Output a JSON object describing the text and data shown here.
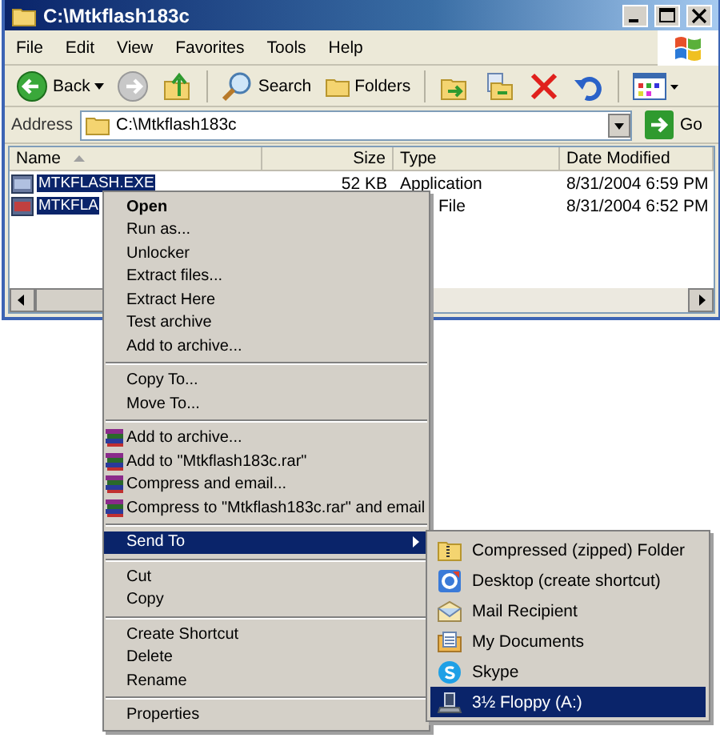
{
  "window": {
    "title": "C:\\Mtkflash183c"
  },
  "menu_bar": [
    "File",
    "Edit",
    "View",
    "Favorites",
    "Tools",
    "Help"
  ],
  "toolbar": [
    {
      "kind": "back",
      "label": "Back"
    },
    {
      "kind": "forward"
    },
    {
      "kind": "up"
    },
    {
      "kind": "separator"
    },
    {
      "kind": "search",
      "label": "Search"
    },
    {
      "kind": "folders",
      "label": "Folders"
    },
    {
      "kind": "separator"
    },
    {
      "kind": "move"
    },
    {
      "kind": "copy"
    },
    {
      "kind": "delete"
    },
    {
      "kind": "undo"
    },
    {
      "kind": "separator"
    },
    {
      "kind": "views"
    }
  ],
  "address": {
    "label": "Address",
    "value": "C:\\Mtkflash183c",
    "go": "Go"
  },
  "file_list": {
    "columns": [
      "Name",
      "Size",
      "Type",
      "Date Modified"
    ],
    "rows": [
      {
        "name": "MTKFLASH.EXE",
        "size": "52 KB",
        "type": "Application",
        "date": "8/31/2004 6:59 PM",
        "selected": true
      },
      {
        "name": "MTKFLA",
        "type": "File",
        "date": "8/31/2004 6:52 PM",
        "selected": true
      }
    ]
  },
  "context_menu": [
    {
      "kind": "bold",
      "label": "Open",
      "selected": false
    },
    {
      "kind": "plain",
      "label": "Run as...",
      "selected": false
    },
    {
      "kind": "plain",
      "label": "Unlocker",
      "selected": false
    },
    {
      "kind": "plain",
      "label": "Extract files...",
      "selected": false
    },
    {
      "kind": "plain",
      "label": "Extract Here",
      "selected": false
    },
    {
      "kind": "plain",
      "label": "Test archive",
      "selected": false
    },
    {
      "kind": "plain",
      "label": "Add to archive...",
      "selected": false
    },
    {
      "kind": "separator"
    },
    {
      "kind": "plain",
      "label": "Copy To...",
      "selected": false
    },
    {
      "kind": "plain",
      "label": "Move To...",
      "selected": false
    },
    {
      "kind": "separator"
    },
    {
      "kind": "archive",
      "label": "Add to archive...",
      "selected": false
    },
    {
      "kind": "archive",
      "label": "Add to \"Mtkflash183c.rar\"",
      "selected": false
    },
    {
      "kind": "archive",
      "label": "Compress and email...",
      "selected": false
    },
    {
      "kind": "archive",
      "label": "Compress to \"Mtkflash183c.rar\" and email",
      "selected": false
    },
    {
      "kind": "separator"
    },
    {
      "kind": "submenu",
      "label": "Send To",
      "selected": true
    },
    {
      "kind": "separator"
    },
    {
      "kind": "plain",
      "label": "Cut",
      "selected": false
    },
    {
      "kind": "plain",
      "label": "Copy",
      "selected": false
    },
    {
      "kind": "separator"
    },
    {
      "kind": "plain",
      "label": "Create Shortcut",
      "selected": false
    },
    {
      "kind": "plain",
      "label": "Delete",
      "selected": false
    },
    {
      "kind": "plain",
      "label": "Rename",
      "selected": false
    },
    {
      "kind": "separator"
    },
    {
      "kind": "plain",
      "label": "Properties",
      "selected": false
    }
  ],
  "send_to_menu": [
    {
      "kind": "zip",
      "label": "Compressed (zipped) Folder",
      "selected": false
    },
    {
      "kind": "desktop",
      "label": "Desktop (create shortcut)",
      "selected": false
    },
    {
      "kind": "mail",
      "label": "Mail Recipient",
      "selected": false
    },
    {
      "kind": "documents",
      "label": "My Documents",
      "selected": false
    },
    {
      "kind": "skype",
      "label": "Skype",
      "selected": false
    },
    {
      "kind": "floppy",
      "label": "3½ Floppy (A:)",
      "selected": true
    }
  ]
}
